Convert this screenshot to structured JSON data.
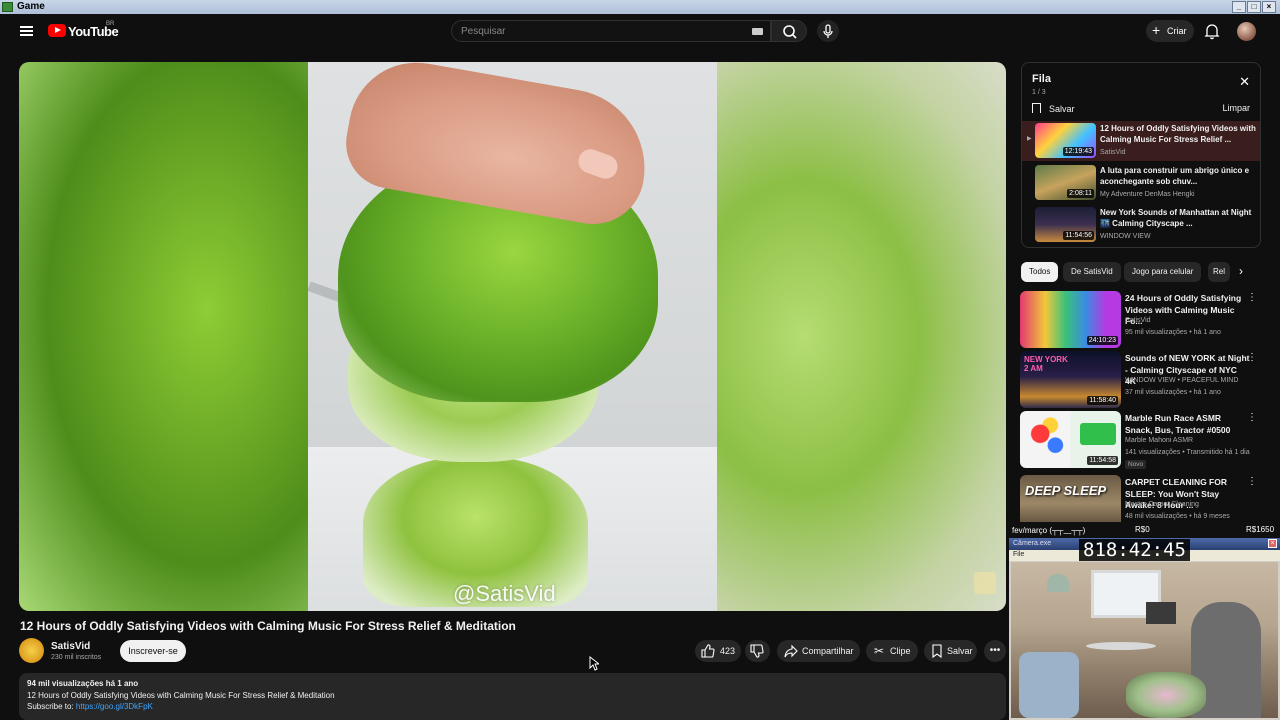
{
  "os_window": {
    "title": "Game"
  },
  "header": {
    "brand": "YouTube",
    "country": "BR",
    "search_placeholder": "Pesquisar",
    "create_label": "Criar"
  },
  "video": {
    "watermark": "@SatisVid",
    "title": "12 Hours of Oddly Satisfying Videos with Calming Music For Stress Relief & Meditation",
    "channel": "SatisVid",
    "subscribers": "230 mil inscritos",
    "subscribe_label": "Inscrever-se",
    "likes": "423",
    "share_label": "Compartilhar",
    "clip_label": "Clipe",
    "save_label": "Salvar"
  },
  "description": {
    "stats": "94 mil visualizações  há 1 ano",
    "line1": "12 Hours of Oddly Satisfying Videos with Calming Music For Stress Relief & Meditation",
    "line2_prefix": "Subscribe to: ",
    "line2_link": "https://goo.gl/3DkFpK"
  },
  "queue": {
    "title": "Fila",
    "count": "1 / 3",
    "save_label": "Salvar",
    "clear_label": "Limpar",
    "items": [
      {
        "title": "12 Hours of Oddly Satisfying Videos with Calming Music For Stress Relief ...",
        "channel": "SatisVid",
        "duration": "12:19:43"
      },
      {
        "title": "A luta para construir um abrigo único e aconchegante sob chuv...",
        "channel": "My Adventure DenMas Hengki",
        "duration": "2:08:11"
      },
      {
        "title": "New York Sounds of Manhattan at Night 🌃 Calming Cityscape ...",
        "channel": "WINDOW VIEW",
        "duration": "11:54:56"
      }
    ]
  },
  "chips": [
    "Todos",
    "De SatisVid",
    "Jogo para celular",
    "Rel"
  ],
  "recommendations": [
    {
      "title": "24 Hours of Oddly Satisfying Videos with Calming Music Fo...",
      "channel": "SatisVid",
      "meta": "95 mil visualizações • há 1 ano",
      "duration": "24:10:23"
    },
    {
      "title": "Sounds of NEW YORK at Night - Calming Cityscape of NYC 4K",
      "channel": "WINDOW VIEW • PEACEFUL MIND",
      "meta": "37 mil visualizações • há 1 ano",
      "duration": "11:58:40",
      "thumb_text": "NEW YORK 2 AM"
    },
    {
      "title": "Marble Run Race ASMR Snack, Bus, Tractor #0500",
      "channel": "Marble Mahoni ASMR",
      "meta": "141 visualizações • Transmitido há 1 dia",
      "duration": "11:54:58",
      "badge": "Novo"
    },
    {
      "title": "CARPET CLEANING FOR SLEEP: You Won't Stay Awake! 8 Hour ...",
      "channel": "Master Carpet Cleaning",
      "meta": "48 mil visualizações • há 9 meses",
      "thumb_text": "DEEP SLEEP"
    }
  ],
  "overlay": {
    "label": "fev/março (┬┬﹏┬┬)",
    "r1": "R$0",
    "r2": "R$1650",
    "window_title": "Câmera.exe",
    "menu": "File",
    "timer": "818:42:45"
  }
}
